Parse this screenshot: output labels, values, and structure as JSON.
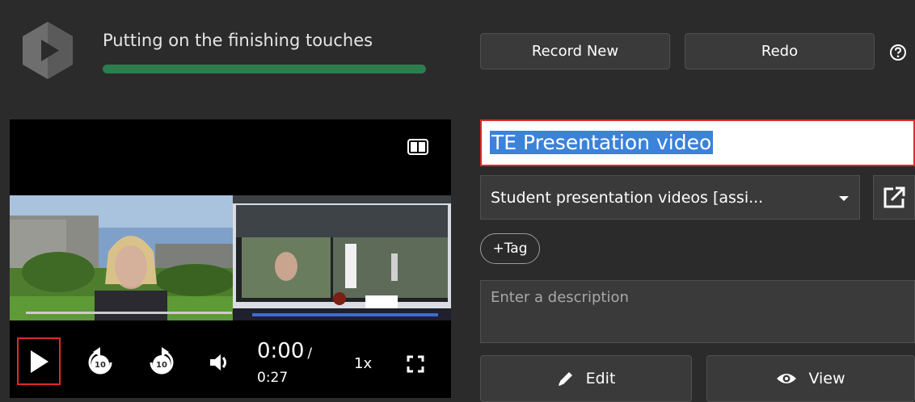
{
  "header": {
    "status_text": "Putting on the finishing touches",
    "progress_fraction": 1.0,
    "progress_color": "#2e7d4f",
    "record_new_label": "Record New",
    "redo_label": "Redo"
  },
  "player": {
    "current_time": "0:00",
    "time_separator": "/",
    "total_time": "0:27",
    "speed": "1x"
  },
  "form": {
    "title_value": "TE Presentation video",
    "folder_value": "Student presentation videos [assi...",
    "tag_label": "+Tag",
    "description_placeholder": "Enter a description",
    "edit_label": "Edit",
    "view_label": "View"
  },
  "colors": {
    "background": "#2b2b2b",
    "button_bg": "#3a3a3a",
    "highlight_border": "#e0282e",
    "selection": "#3b82d9"
  }
}
